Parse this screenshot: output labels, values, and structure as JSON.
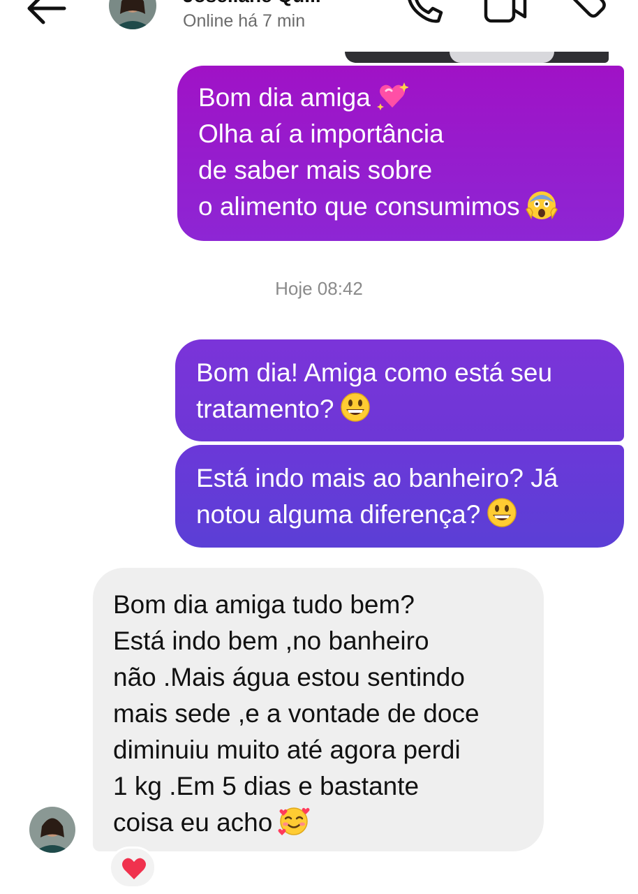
{
  "header": {
    "back_icon": "arrow-left-icon",
    "contact_name": "Joseliane Qu...",
    "presence": "Online há 7 min",
    "actions": [
      "phone-icon",
      "video-camera-icon",
      "tag-icon"
    ]
  },
  "messages": [
    {
      "direction": "outgoing",
      "lines": [
        "Bom dia amiga",
        "Olha aí a importância",
        "de saber mais sobre",
        "o alimento que consumimos"
      ],
      "emojis": [
        "sparkling-heart",
        "face-screaming-in-fear"
      ]
    },
    {
      "direction": "outgoing",
      "lines": [
        "Bom dia! Amiga como está seu",
        "tratamento?"
      ],
      "emojis": [
        "grinning-face"
      ]
    },
    {
      "direction": "outgoing",
      "lines": [
        "Está indo mais ao banheiro? Já",
        "notou alguma diferença?"
      ],
      "emojis": [
        "grinning-face"
      ]
    },
    {
      "direction": "incoming",
      "lines": [
        "Bom dia amiga tudo bem?",
        "Está indo bem ,no banheiro",
        "não .Mais água estou sentindo",
        "mais sede ,e a vontade de doce",
        "diminuiu muito  até agora perdi",
        "1 kg .Em 5 dias e bastante",
        "coisa eu acho"
      ],
      "emojis": [
        "smiling-face-with-hearts"
      ],
      "reaction": "red-heart"
    }
  ],
  "time_divider": "Hoje 08:42",
  "colors": {
    "outgoing_top": "#a012c6",
    "outgoing_mid": "#7b34d9",
    "outgoing_bottom": "#5b3fd6",
    "incoming_bg": "#efefef",
    "secondary_text": "#8a8a8a"
  }
}
